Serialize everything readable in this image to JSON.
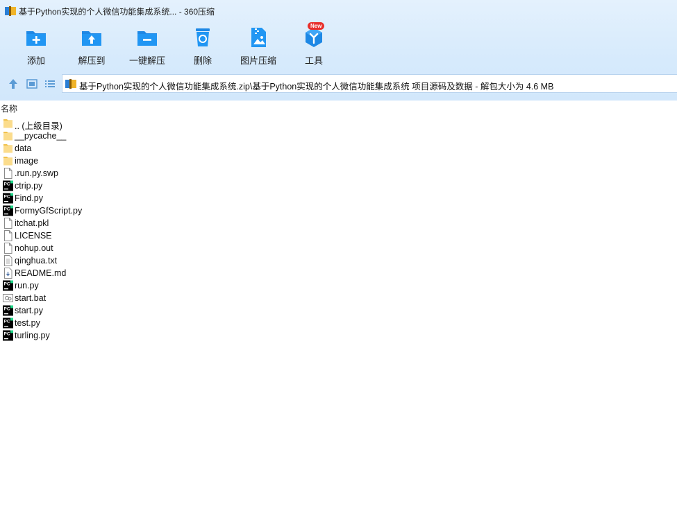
{
  "window": {
    "title": "基于Python实现的个人微信功能集成系统... - 360压缩"
  },
  "toolbar": {
    "buttons": [
      {
        "label": "添加",
        "icon": "add-folder-icon"
      },
      {
        "label": "解压到",
        "icon": "extract-to-icon"
      },
      {
        "label": "一键解压",
        "icon": "one-click-extract-icon"
      },
      {
        "label": "删除",
        "icon": "recycle-bin-icon"
      },
      {
        "label": "图片压缩",
        "icon": "image-compress-icon"
      },
      {
        "label": "工具",
        "icon": "tools-icon",
        "badge": "New"
      }
    ]
  },
  "nav": {
    "icons": [
      "up-arrow-icon",
      "thumbnail-view-icon",
      "list-view-icon"
    ],
    "address": "基于Python实现的个人微信功能集成系统.zip\\基于Python实现的个人微信功能集成系统 项目源码及数据 - 解包大小为 4.6 MB"
  },
  "columns": {
    "name": "名称"
  },
  "files": [
    {
      "name": ".. (上级目录)",
      "type": "folder"
    },
    {
      "name": "__pycache__",
      "type": "folder"
    },
    {
      "name": "data",
      "type": "folder"
    },
    {
      "name": "image",
      "type": "folder"
    },
    {
      "name": ".run.py.swp",
      "type": "file"
    },
    {
      "name": "ctrip.py",
      "type": "pycharm"
    },
    {
      "name": "Find.py",
      "type": "pycharm"
    },
    {
      "name": "FormyGfScript.py",
      "type": "pycharm"
    },
    {
      "name": "itchat.pkl",
      "type": "file"
    },
    {
      "name": "LICENSE",
      "type": "file"
    },
    {
      "name": "nohup.out",
      "type": "file"
    },
    {
      "name": "qinghua.txt",
      "type": "text"
    },
    {
      "name": "README.md",
      "type": "markdown"
    },
    {
      "name": "run.py",
      "type": "pycharm"
    },
    {
      "name": "start.bat",
      "type": "batch"
    },
    {
      "name": "start.py",
      "type": "pycharm"
    },
    {
      "name": "test.py",
      "type": "pycharm"
    },
    {
      "name": "turling.py",
      "type": "pycharm"
    }
  ],
  "colors": {
    "accent": "#1e88e5",
    "header_bg": "#d6eafc",
    "folder": "#f9d67a",
    "badge": "#e8302c"
  }
}
